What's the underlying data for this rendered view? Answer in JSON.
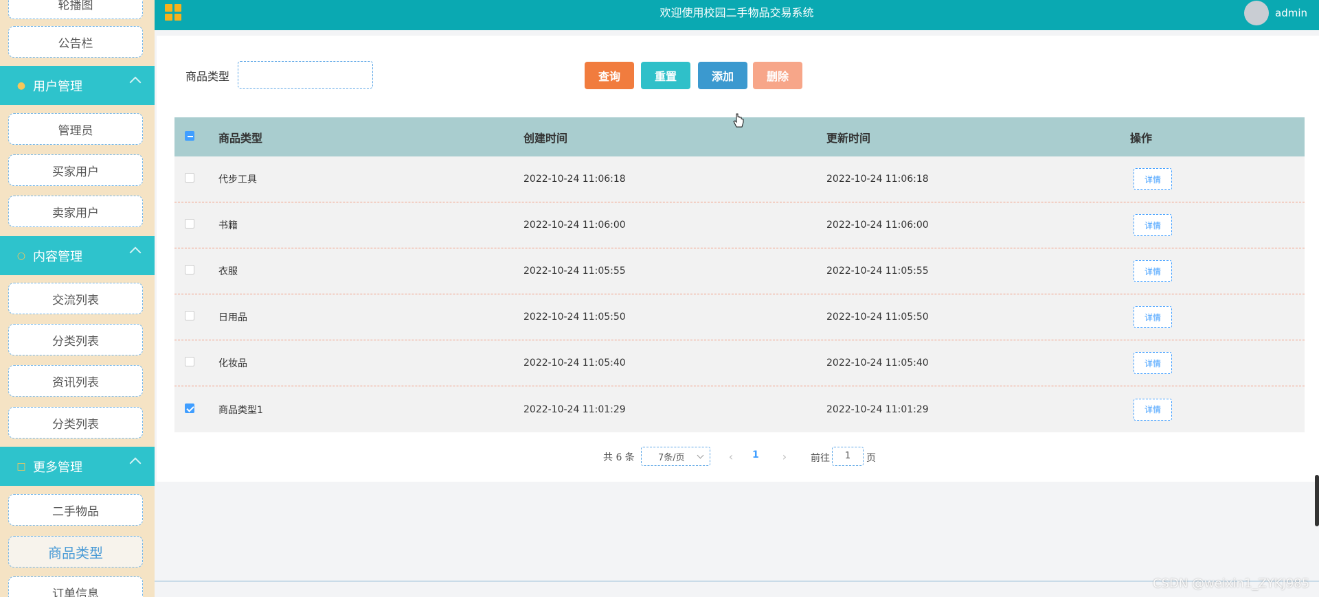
{
  "header": {
    "title": "欢迎使用校园二手物品交易系统",
    "username": "admin"
  },
  "sidebar": {
    "top_items": [
      "轮播图",
      "公告栏"
    ],
    "groups": [
      {
        "label": "用户管理",
        "items": [
          "管理员",
          "买家用户",
          "卖家用户"
        ]
      },
      {
        "label": "内容管理",
        "items": [
          "交流列表",
          "分类列表",
          "资讯列表",
          "分类列表"
        ]
      },
      {
        "label": "更多管理",
        "items": [
          "二手物品",
          "商品类型",
          "订单信息"
        ]
      }
    ],
    "active_item": "商品类型"
  },
  "filter": {
    "label": "商品类型",
    "value": "",
    "search_label": "查询",
    "reset_label": "重置",
    "add_label": "添加",
    "delete_label": "删除"
  },
  "table": {
    "headers": [
      "商品类型",
      "创建时间",
      "更新时间",
      "操作"
    ],
    "rows": [
      {
        "type": "代步工具",
        "created": "2022-10-24 11:06:18",
        "updated": "2022-10-24 11:06:18",
        "action": "详情",
        "checked": false
      },
      {
        "type": "书籍",
        "created": "2022-10-24 11:06:00",
        "updated": "2022-10-24 11:06:00",
        "action": "详情",
        "checked": false
      },
      {
        "type": "衣服",
        "created": "2022-10-24 11:05:55",
        "updated": "2022-10-24 11:05:55",
        "action": "详情",
        "checked": false
      },
      {
        "type": "日用品",
        "created": "2022-10-24 11:05:50",
        "updated": "2022-10-24 11:05:50",
        "action": "详情",
        "checked": false
      },
      {
        "type": "化妆品",
        "created": "2022-10-24 11:05:40",
        "updated": "2022-10-24 11:05:40",
        "action": "详情",
        "checked": false
      },
      {
        "type": "商品类型1",
        "created": "2022-10-24 11:01:29",
        "updated": "2022-10-24 11:01:29",
        "action": "详情",
        "checked": true
      }
    ]
  },
  "pagination": {
    "total_text": "共 6 条",
    "page_size": "7条/页",
    "current_page": "1",
    "goto_label": "前往",
    "goto_value": "1",
    "page_unit": "页"
  },
  "watermark": "CSDN @weixin1_ZYKJ985",
  "colors": {
    "header": "#0aa9b2",
    "sidebar_bg": "#f5e3c4",
    "group_bg": "#2ec3cc",
    "search_btn": "#f17c3e",
    "reset_btn": "#2fc0c9",
    "add_btn": "#3b99cf",
    "delete_btn": "#f7a689",
    "table_header": "#a9cdcf"
  }
}
